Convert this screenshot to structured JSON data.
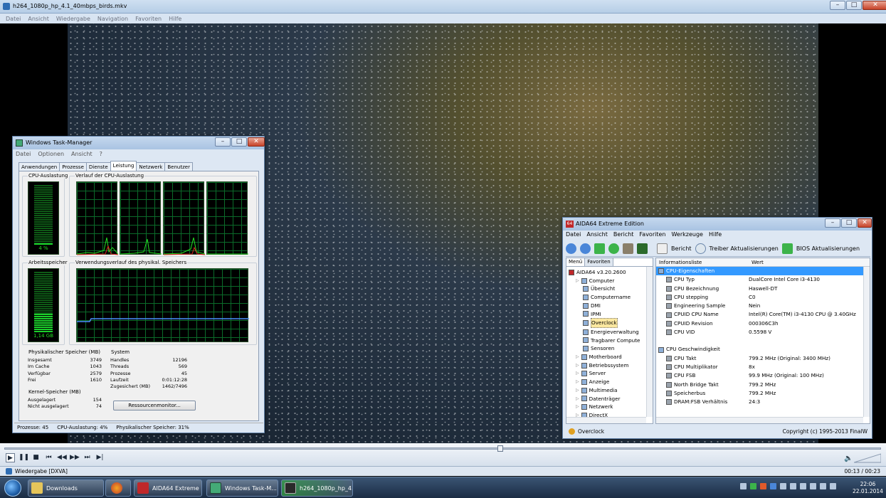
{
  "player": {
    "title": "h264_1080p_hp_4.1_40mbps_birds.mkv",
    "menu": [
      "Datei",
      "Ansicht",
      "Wiedergabe",
      "Navigation",
      "Favoriten",
      "Hilfe"
    ],
    "status_left": "Wiedergabe [DXVA]",
    "time": "00:13 / 00:23"
  },
  "taskmgr": {
    "title": "Windows Task-Manager",
    "menu": [
      "Datei",
      "Optionen",
      "Ansicht",
      "?"
    ],
    "tabs": [
      "Anwendungen",
      "Prozesse",
      "Dienste",
      "Leistung",
      "Netzwerk",
      "Benutzer"
    ],
    "cpu_usage_label": "CPU-Auslastung",
    "cpu_history_label": "Verlauf der CPU-Auslastung",
    "cpu_value": "4 %",
    "cpu_fraction": 0.04,
    "mem_label": "Arbeitsspeicher",
    "mem_history_label": "Verwendungsverlauf des physikal. Speichers",
    "mem_value": "1,14 GB",
    "mem_fraction": 0.31,
    "phys_title": "Physikalischer Speicher (MB)",
    "phys": [
      {
        "k": "Insgesamt",
        "v": "3749"
      },
      {
        "k": "Im Cache",
        "v": "1043"
      },
      {
        "k": "Verfügbar",
        "v": "2579"
      },
      {
        "k": "Frei",
        "v": "1610"
      }
    ],
    "sys_title": "System",
    "sys": [
      {
        "k": "Handles",
        "v": "12196"
      },
      {
        "k": "Threads",
        "v": "569"
      },
      {
        "k": "Prozesse",
        "v": "45"
      },
      {
        "k": "Laufzeit",
        "v": "0:01:12:28"
      },
      {
        "k": "Zugesichert (MB)",
        "v": "1462/7496"
      }
    ],
    "kernel_title": "Kernel-Speicher (MB)",
    "kernel": [
      {
        "k": "Ausgelagert",
        "v": "154"
      },
      {
        "k": "Nicht ausgelagert",
        "v": "74"
      }
    ],
    "resmon_button": "Ressourcenmonitor...",
    "status": [
      "Prozesse: 45",
      "CPU-Auslastung: 4%",
      "Physikalischer Speicher: 31%"
    ]
  },
  "aida": {
    "title": "AIDA64 Extreme Edition",
    "menu": [
      "Datei",
      "Ansicht",
      "Bericht",
      "Favoriten",
      "Werkzeuge",
      "Hilfe"
    ],
    "toolbar": {
      "report": "Bericht",
      "driver": "Treiber Aktualisierungen",
      "bios": "BIOS Aktualisierungen"
    },
    "left_tabs": [
      "Menü",
      "Favoriten"
    ],
    "tree": [
      {
        "label": "AIDA64 v3.20.2600",
        "level": 0
      },
      {
        "label": "Computer",
        "level": 1
      },
      {
        "label": "Übersicht",
        "level": 2
      },
      {
        "label": "Computername",
        "level": 2
      },
      {
        "label": "DMI",
        "level": 2
      },
      {
        "label": "IPMI",
        "level": 2
      },
      {
        "label": "Overclock",
        "level": 2,
        "selected": true
      },
      {
        "label": "Energieverwaltung",
        "level": 2
      },
      {
        "label": "Tragbarer Compute",
        "level": 2
      },
      {
        "label": "Sensoren",
        "level": 2
      },
      {
        "label": "Motherboard",
        "level": 1
      },
      {
        "label": "Betriebssystem",
        "level": 1
      },
      {
        "label": "Server",
        "level": 1
      },
      {
        "label": "Anzeige",
        "level": 1
      },
      {
        "label": "Multimedia",
        "level": 1
      },
      {
        "label": "Datenträger",
        "level": 1
      },
      {
        "label": "Netzwerk",
        "level": 1
      },
      {
        "label": "DirectX",
        "level": 1
      }
    ],
    "col_info": "Informationsliste",
    "col_value": "Wert",
    "sec1": "CPU-Eigenschaften",
    "rows1": [
      {
        "k": "CPU Typ",
        "v": "DualCore Intel Core i3-4130"
      },
      {
        "k": "CPU Bezeichnung",
        "v": "Haswell-DT"
      },
      {
        "k": "CPU stepping",
        "v": "C0"
      },
      {
        "k": "Engineering Sample",
        "v": "Nein"
      },
      {
        "k": "CPUID CPU Name",
        "v": "Intel(R) Core(TM) i3-4130 CPU @ 3.40GHz"
      },
      {
        "k": "CPUID Revision",
        "v": "000306C3h"
      },
      {
        "k": "CPU VID",
        "v": "0.5598 V"
      }
    ],
    "sec2": "CPU Geschwindigkeit",
    "rows2": [
      {
        "k": "CPU Takt",
        "v": "799.2 MHz  (Original: 3400 MHz)"
      },
      {
        "k": "CPU Multiplikator",
        "v": "8x"
      },
      {
        "k": "CPU FSB",
        "v": "99.9 MHz  (Original: 100 MHz)"
      },
      {
        "k": "North Bridge Takt",
        "v": "799.2 MHz"
      },
      {
        "k": "Speicherbus",
        "v": "799.2 MHz"
      },
      {
        "k": "DRAM:FSB Verhältnis",
        "v": "24:3"
      }
    ],
    "status_left": "Overclock",
    "status_right": "Copyright (c) 1995-2013 FinalW"
  },
  "taskbar": {
    "items": [
      "Downloads",
      "AIDA64 Extreme E...",
      "Windows Task-M...",
      "h264_1080p_hp_4...."
    ],
    "time": "22:06",
    "date": "22.01.2014"
  },
  "colors": {
    "graph_green": "#1bd12b",
    "selection": "#3399ff",
    "taskbar": "#1b2c44"
  }
}
